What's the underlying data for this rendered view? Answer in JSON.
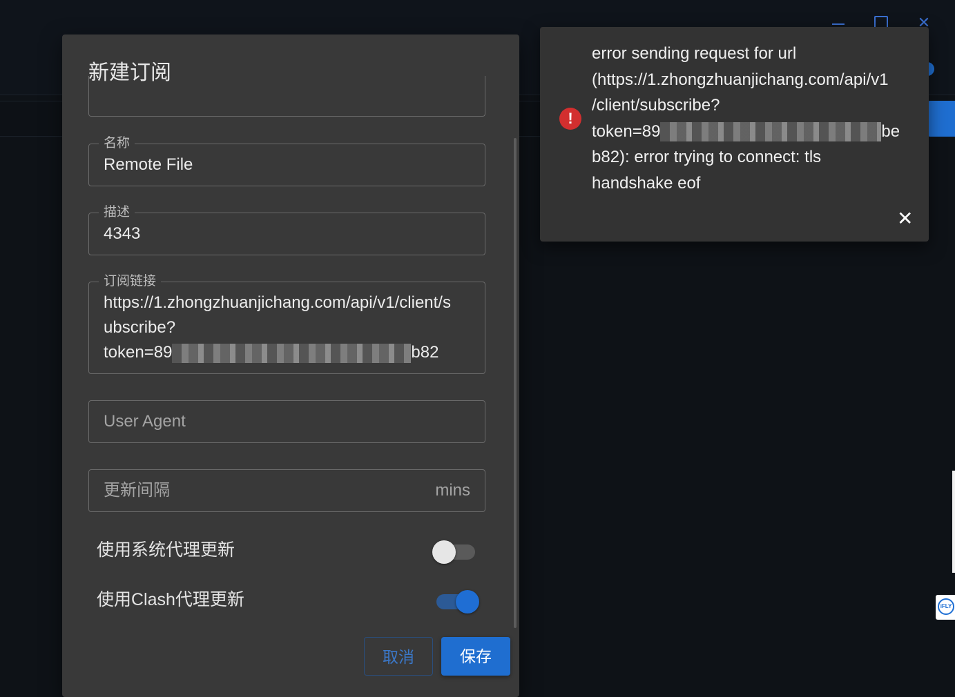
{
  "window": {
    "minimize_icon": "minimize-icon",
    "maximize_icon": "maximize-icon",
    "close_icon": "close-icon"
  },
  "dialog": {
    "title": "新建订阅",
    "fields": {
      "name": {
        "label": "名称",
        "value": "Remote File"
      },
      "description": {
        "label": "描述",
        "value": "4343"
      },
      "url": {
        "label": "订阅链接",
        "line1": "https://1.zhongzhuanjichang.com/api/v1/client/s",
        "line2": "ubscribe?",
        "line3_prefix": "token=89",
        "line3_suffix": "b82"
      },
      "user_agent": {
        "placeholder": "User Agent"
      },
      "update_interval": {
        "placeholder": "更新间隔",
        "suffix": "mins"
      }
    },
    "toggles": {
      "system_proxy": {
        "label": "使用系统代理更新",
        "checked": false
      },
      "clash_proxy": {
        "label": "使用Clash代理更新",
        "checked": true
      }
    },
    "buttons": {
      "cancel": "取消",
      "save": "保存"
    }
  },
  "notification": {
    "icon": "error-icon",
    "line1": "error sending request for url",
    "line2": "(https://1.zhongzhuanjichang.com/api/v1",
    "line3": "/client/subscribe?",
    "line4_prefix": "token=89",
    "line4_suffix": "be",
    "line5": "b82): error trying to connect: tls",
    "line6": "handshake eof",
    "close_icon": "close-icon"
  },
  "colors": {
    "accent": "#1f6ed0",
    "error": "#d32f2f",
    "dialog_bg": "#393939",
    "notice_bg": "#333333"
  }
}
